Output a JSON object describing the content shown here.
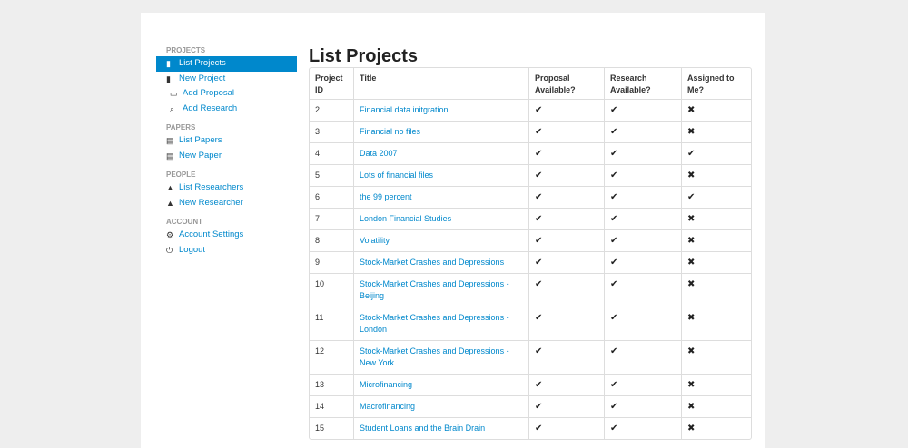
{
  "sidebar": {
    "sections": [
      {
        "header": "PROJECTS",
        "items": [
          {
            "label": "List Projects",
            "icon": "book-icon",
            "glyph": "▮",
            "active": true,
            "sub": false
          },
          {
            "label": "New Project",
            "icon": "book-icon",
            "glyph": "▮",
            "active": false,
            "sub": false
          },
          {
            "label": "Add Proposal",
            "icon": "road-icon",
            "glyph": "▭",
            "active": false,
            "sub": true
          },
          {
            "label": "Add Research",
            "icon": "search-icon",
            "glyph": "⌕",
            "active": false,
            "sub": true
          }
        ]
      },
      {
        "header": "PAPERS",
        "items": [
          {
            "label": "List Papers",
            "icon": "file-icon",
            "glyph": "▤",
            "active": false,
            "sub": false
          },
          {
            "label": "New Paper",
            "icon": "file-icon",
            "glyph": "▤",
            "active": false,
            "sub": false
          }
        ]
      },
      {
        "header": "PEOPLE",
        "items": [
          {
            "label": "List Researchers",
            "icon": "user-icon",
            "glyph": "▲",
            "active": false,
            "sub": false
          },
          {
            "label": "New Researcher",
            "icon": "user-icon",
            "glyph": "▲",
            "active": false,
            "sub": false
          }
        ]
      },
      {
        "header": "ACCOUNT",
        "items": [
          {
            "label": "Account Settings",
            "icon": "cog-icon",
            "glyph": "⚙",
            "active": false,
            "sub": false
          },
          {
            "label": "Logout",
            "icon": "power-icon",
            "glyph": "⏻",
            "active": false,
            "sub": false
          }
        ]
      }
    ]
  },
  "main": {
    "title": "List Projects",
    "columns": [
      "Project ID",
      "Title",
      "Proposal Available?",
      "Research Available?",
      "Assigned to Me?"
    ],
    "rows": [
      {
        "id": "2",
        "title": "Financial data initgration",
        "proposal": true,
        "research": true,
        "assigned": false
      },
      {
        "id": "3",
        "title": "Financial no files",
        "proposal": true,
        "research": true,
        "assigned": false
      },
      {
        "id": "4",
        "title": "Data 2007",
        "proposal": true,
        "research": true,
        "assigned": true
      },
      {
        "id": "5",
        "title": "Lots of financial files",
        "proposal": true,
        "research": true,
        "assigned": false
      },
      {
        "id": "6",
        "title": "the 99 percent",
        "proposal": true,
        "research": true,
        "assigned": true
      },
      {
        "id": "7",
        "title": "London Financial Studies",
        "proposal": true,
        "research": true,
        "assigned": false
      },
      {
        "id": "8",
        "title": "Volatility",
        "proposal": true,
        "research": true,
        "assigned": false
      },
      {
        "id": "9",
        "title": "Stock-Market Crashes and Depressions",
        "proposal": true,
        "research": true,
        "assigned": false
      },
      {
        "id": "10",
        "title": "Stock-Market Crashes and Depressions - Beijing",
        "proposal": true,
        "research": true,
        "assigned": false
      },
      {
        "id": "11",
        "title": "Stock-Market Crashes and Depressions - London",
        "proposal": true,
        "research": true,
        "assigned": false
      },
      {
        "id": "12",
        "title": "Stock-Market Crashes and Depressions - New York",
        "proposal": true,
        "research": true,
        "assigned": false
      },
      {
        "id": "13",
        "title": "Microfinancing",
        "proposal": true,
        "research": true,
        "assigned": false
      },
      {
        "id": "14",
        "title": "Macrofinancing",
        "proposal": true,
        "research": true,
        "assigned": false
      },
      {
        "id": "15",
        "title": "Student Loans and the Brain Drain",
        "proposal": true,
        "research": true,
        "assigned": false
      }
    ]
  },
  "glyphs": {
    "check": "✔",
    "cross": "✖"
  }
}
